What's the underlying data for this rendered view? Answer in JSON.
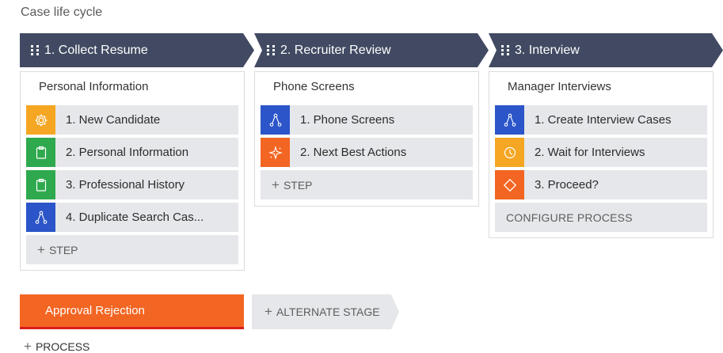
{
  "page": {
    "title": "Case life cycle"
  },
  "stages": [
    {
      "label": "1.  Collect Resume",
      "process": {
        "title": "Personal Information",
        "steps": [
          {
            "label": "1.  New Candidate",
            "icon": "gear-icon",
            "color": "#f5a623"
          },
          {
            "label": "2.  Personal Information",
            "icon": "clipboard-icon",
            "color": "#2fa94e"
          },
          {
            "label": "3.  Professional History",
            "icon": "clipboard-icon",
            "color": "#2fa94e"
          },
          {
            "label": "4.  Duplicate Search Cas...",
            "icon": "branch-icon",
            "color": "#2b55c8"
          }
        ],
        "add_step_label": "STEP"
      }
    },
    {
      "label": "2.  Recruiter Review",
      "process": {
        "title": "Phone Screens",
        "steps": [
          {
            "label": "1.  Phone Screens",
            "icon": "branch-icon",
            "color": "#2b55c8"
          },
          {
            "label": "2.  Next Best Actions",
            "icon": "sparkle-icon",
            "color": "#f26522"
          }
        ],
        "add_step_label": "STEP"
      }
    },
    {
      "label": "3.  Interview",
      "process": {
        "title": "Manager Interviews",
        "steps": [
          {
            "label": "1.  Create Interview Cases",
            "icon": "branch-icon",
            "color": "#2b55c8"
          },
          {
            "label": "2.  Wait for Interviews",
            "icon": "clock-icon",
            "color": "#f5a623"
          },
          {
            "label": "3.  Proceed?",
            "icon": "diamond-icon",
            "color": "#f26522"
          }
        ],
        "configure_label": "CONFIGURE PROCESS"
      }
    }
  ],
  "alternate_stage": {
    "label": "Approval Rejection",
    "color": "#f26522",
    "underline_color": "#d91c1c"
  },
  "add_alternate_stage_label": "ALTERNATE STAGE",
  "add_process_label": "PROCESS",
  "colors": {
    "chevron": "#414a62",
    "step_bg": "#e6e7ea"
  }
}
